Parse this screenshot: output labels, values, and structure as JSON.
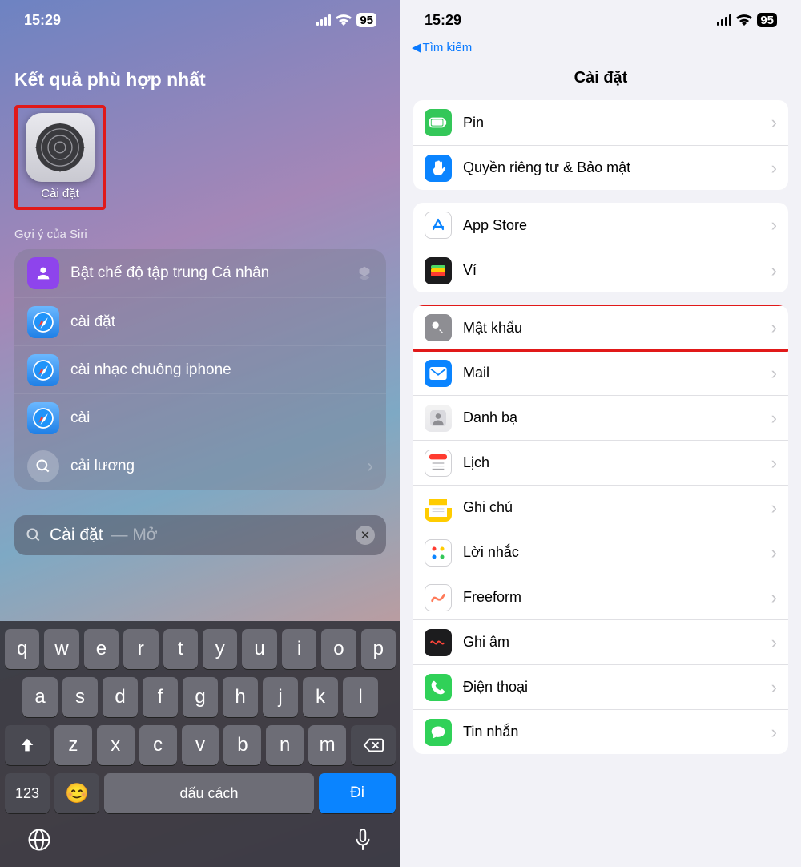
{
  "status": {
    "time": "15:29",
    "battery": "95"
  },
  "left": {
    "top_hit_header": "Kết quả phù hợp nhất",
    "app": {
      "label": "Cài đặt"
    },
    "siri_header": "Gợi ý của Siri",
    "suggestions": [
      {
        "icon": "focus",
        "label": "Bật chế độ tập trung Cá nhân"
      },
      {
        "icon": "safari",
        "label": "cài đặt"
      },
      {
        "icon": "safari",
        "label": "cài nhạc chuông iphone"
      },
      {
        "icon": "safari",
        "label": "cài"
      },
      {
        "icon": "search",
        "label": "cải lương"
      }
    ],
    "search": {
      "query": "Cài đặt",
      "hint": "— Mở"
    },
    "keyboard": {
      "r1": [
        "q",
        "w",
        "e",
        "r",
        "t",
        "y",
        "u",
        "i",
        "o",
        "p"
      ],
      "r2": [
        "a",
        "s",
        "d",
        "f",
        "g",
        "h",
        "j",
        "k",
        "l"
      ],
      "r3": [
        "z",
        "x",
        "c",
        "v",
        "b",
        "n",
        "m"
      ],
      "num": "123",
      "space": "dấu cách",
      "go": "Đi"
    }
  },
  "right": {
    "back": "Tìm kiếm",
    "title": "Cài đặt",
    "groups": [
      {
        "rows": [
          {
            "icon": "battery",
            "bg": "bg-green",
            "label": "Pin"
          },
          {
            "icon": "hand",
            "bg": "bg-blue",
            "label": "Quyền riêng tư & Bảo mật"
          }
        ]
      },
      {
        "rows": [
          {
            "icon": "appstore",
            "bg": "bg-white",
            "label": "App Store"
          },
          {
            "icon": "wallet",
            "bg": "bg-dark",
            "label": "Ví"
          }
        ]
      },
      {
        "rows": [
          {
            "icon": "key",
            "bg": "bg-grey",
            "label": "Mật khẩu",
            "highlight": true
          },
          {
            "icon": "mail",
            "bg": "bg-blue",
            "label": "Mail"
          },
          {
            "icon": "contacts",
            "bg": "bg-orange",
            "label": "Danh bạ"
          },
          {
            "icon": "calendar",
            "bg": "bg-white",
            "label": "Lịch"
          },
          {
            "icon": "notes",
            "bg": "bg-yellow",
            "label": "Ghi chú"
          },
          {
            "icon": "reminders",
            "bg": "bg-white",
            "label": "Lời nhắc"
          },
          {
            "icon": "freeform",
            "bg": "bg-white",
            "label": "Freeform"
          },
          {
            "icon": "voicememo",
            "bg": "bg-dark",
            "label": "Ghi âm"
          },
          {
            "icon": "phone",
            "bg": "bg-call",
            "label": "Điện thoại"
          },
          {
            "icon": "messages",
            "bg": "bg-msg",
            "label": "Tin nhắn"
          }
        ]
      }
    ]
  }
}
